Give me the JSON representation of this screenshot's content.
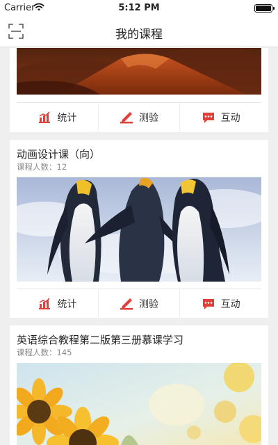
{
  "status_bar": {
    "carrier": "Carrier",
    "time": "5:12 PM"
  },
  "nav": {
    "title": "我的课程"
  },
  "actions": {
    "stats": "统计",
    "quiz": "测验",
    "interact": "互动"
  },
  "courses": [
    {
      "image": "desert-landscape"
    },
    {
      "title": "动画设计课（向）",
      "members": "课程人数：12",
      "image": "penguins"
    },
    {
      "title": "英语综合教程第二版第三册慕课学习",
      "members": "课程人数：145",
      "image": "sunflowers"
    }
  ],
  "colors": {
    "accent": "#e0403a",
    "background": "#efefef"
  }
}
